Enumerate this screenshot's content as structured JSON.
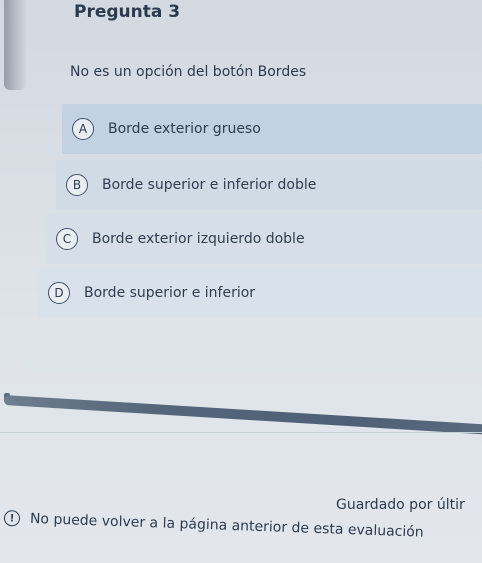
{
  "quiz": {
    "title": "Pregunta 3",
    "question": "No es un opción del botón Bordes",
    "options": [
      {
        "letter": "A",
        "text": "Borde exterior grueso"
      },
      {
        "letter": "B",
        "text": "Borde superior e inferior doble"
      },
      {
        "letter": "C",
        "text": "Borde exterior izquierdo doble"
      },
      {
        "letter": "D",
        "text": "Borde superior e inferior"
      }
    ]
  },
  "footer": {
    "saved_status": "Guardado por últir",
    "notice_icon": "info-icon",
    "notice_text": "No puede volver a la página anterior de esta evaluación"
  },
  "colors": {
    "accent": "#4e6076",
    "selected_option": "#c2d2e2"
  }
}
